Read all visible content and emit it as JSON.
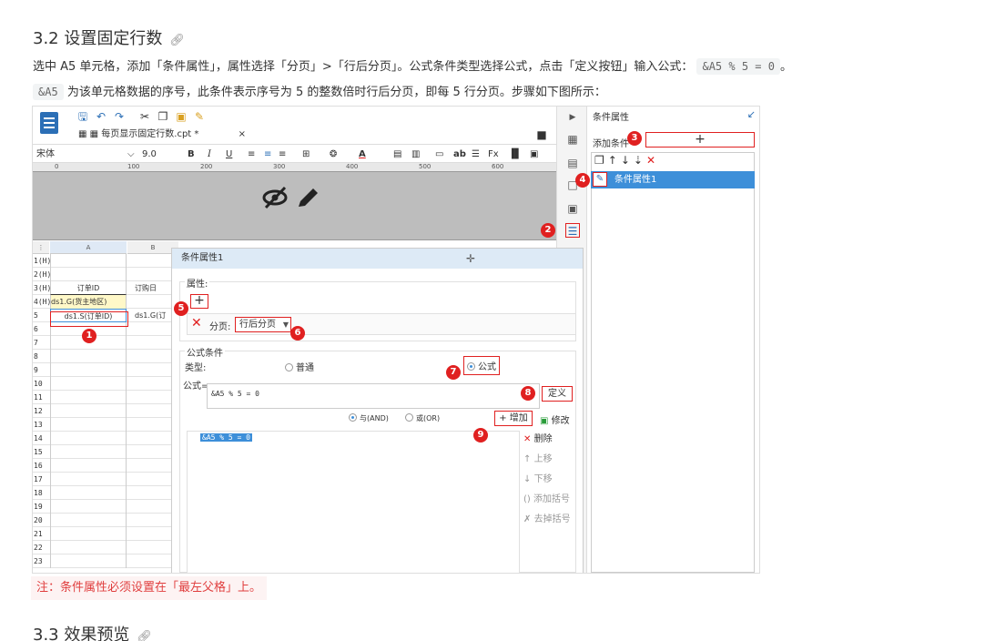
{
  "section_32": {
    "title": "3.2 设置固定行数",
    "link_icon": "link-icon"
  },
  "para1": {
    "text": "选中 A5 单元格，添加「条件属性」，属性选择「分页」>「行后分页」。公式条件类型选择公式，点击「定义按钮」输入公式：",
    "code": "&A5 % 5 = 0",
    "end": "。"
  },
  "para2": {
    "code": "&A5",
    "text": "为该单元格数据的序号，此条件表示序号为 5 的整数倍时行后分页，即每 5 行分页。步骤如下图所示："
  },
  "screenshot": {
    "file_tab": "每页显示固定行数.cpt *",
    "tab_close": "×",
    "font_name": "宋体",
    "font_size": "9.0",
    "ruler_marks": [
      "0",
      "100",
      "200",
      "300",
      "400",
      "500",
      "600"
    ],
    "panel_title": "条件属性",
    "add_condition_label": "添加条件",
    "add_plus": "+",
    "condition_item": "条件属性1",
    "sheet": {
      "col_a": "A",
      "col_b": "B",
      "rows": [
        {
          "h": "1(H)",
          "a": "",
          "b": ""
        },
        {
          "h": "2(H)",
          "a": "",
          "b": ""
        },
        {
          "h": "3(H)",
          "a": "订单ID",
          "b": "订购日"
        },
        {
          "h": "4(H)",
          "a": "ds1.G(货主地区)",
          "b": ""
        },
        {
          "h": "5",
          "a": "ds1.S(订单ID)",
          "b": "ds1.G(订"
        },
        {
          "h": "6",
          "a": "",
          "b": ""
        },
        {
          "h": "7",
          "a": "",
          "b": ""
        },
        {
          "h": "8",
          "a": "",
          "b": ""
        },
        {
          "h": "9",
          "a": "",
          "b": ""
        },
        {
          "h": "10",
          "a": "",
          "b": ""
        },
        {
          "h": "11",
          "a": "",
          "b": ""
        },
        {
          "h": "12",
          "a": "",
          "b": ""
        },
        {
          "h": "13",
          "a": "",
          "b": ""
        },
        {
          "h": "14",
          "a": "",
          "b": ""
        },
        {
          "h": "15",
          "a": "",
          "b": ""
        },
        {
          "h": "16",
          "a": "",
          "b": ""
        },
        {
          "h": "17",
          "a": "",
          "b": ""
        },
        {
          "h": "18",
          "a": "",
          "b": ""
        },
        {
          "h": "19",
          "a": "",
          "b": ""
        },
        {
          "h": "20",
          "a": "",
          "b": ""
        },
        {
          "h": "21",
          "a": "",
          "b": ""
        },
        {
          "h": "22",
          "a": "",
          "b": ""
        },
        {
          "h": "23",
          "a": "",
          "b": ""
        }
      ]
    },
    "dialog": {
      "title": "条件属性1",
      "attr_label": "属性:",
      "attr_plus": "+",
      "page_label": "分页:",
      "page_value": "行后分页",
      "formula_group": "公式条件",
      "type_label": "类型:",
      "type_normal": "普通",
      "type_formula": "公式",
      "formula_label": "公式=",
      "formula_value": "&A5 % 5 = 0",
      "define_btn": "定义",
      "and_label": "与(AND)",
      "or_label": "或(OR)",
      "add_btn": "+ 增加",
      "modify_btn": "修改",
      "delete_btn": "删除",
      "up_btn": "上移",
      "down_btn": "下移",
      "add_paren_btn": "添加括号",
      "remove_paren_btn": "去掉括号",
      "list_item": "&A5 % 5 = 0"
    },
    "markers": [
      "1",
      "2",
      "3",
      "4",
      "5",
      "6",
      "7",
      "8",
      "9"
    ]
  },
  "note": "注：条件属性必须设置在「最左父格」上。",
  "section_33": {
    "title": "3.3 效果预览",
    "link_icon": "link-icon"
  }
}
